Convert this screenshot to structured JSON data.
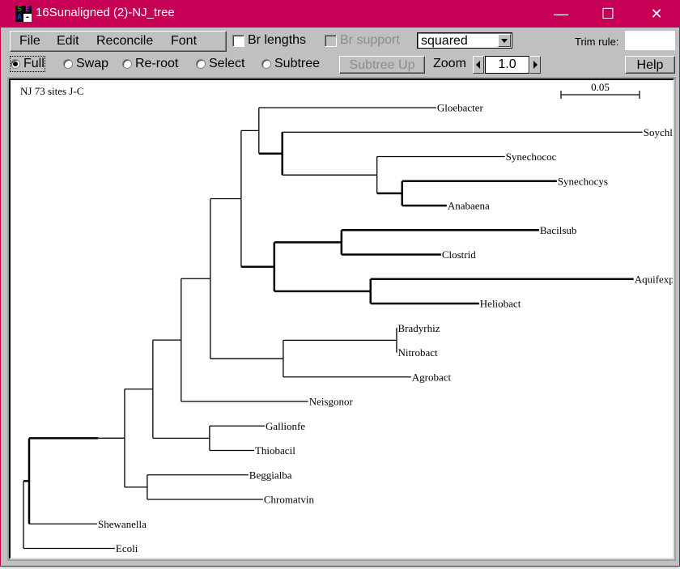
{
  "window": {
    "title": "16Sunaligned (2)-NJ_tree",
    "app_icon_letters": [
      "S",
      "E",
      "A",
      "-"
    ],
    "app_icon_colors": [
      "#00a000",
      "#c000c0",
      "#0040ff",
      "#ffffff"
    ],
    "controls": {
      "minimize": "—",
      "maximize": "☐",
      "close": "✕"
    },
    "titlebar_color": "#c60055"
  },
  "menu": [
    "File",
    "Edit",
    "Reconcile",
    "Font"
  ],
  "toolbar": {
    "br_lengths": {
      "label": "Br lengths",
      "checked": false,
      "enabled": true
    },
    "br_support": {
      "label": "Br support",
      "checked": false,
      "enabled": false
    },
    "tree_style": "squared",
    "trim_rule_label": "Trim rule:",
    "trim_rule_value": "",
    "modes": [
      {
        "label": "Full",
        "selected": true
      },
      {
        "label": "Swap",
        "selected": false
      },
      {
        "label": "Re-root",
        "selected": false
      },
      {
        "label": "Select",
        "selected": false
      },
      {
        "label": "Subtree",
        "selected": false
      }
    ],
    "subtree_up_label": "Subtree Up",
    "zoom_label": "Zoom",
    "zoom_value": "1.0",
    "help_label": "Help"
  },
  "tree": {
    "title": "NJ 73 sites J-C",
    "scale_label": "0.05",
    "scale_value": 0.05,
    "root": {
      "thick": false,
      "children": [
        {
          "len": 0.0036,
          "thick": true,
          "children": [
            {
              "len": 0.0438,
              "thick": true,
              "children": [
                {
                  "len": 0.017,
                  "children": [
                    {
                      "len": 0.018,
                      "children": [
                        {
                          "len": 0.018,
                          "children": [
                            {
                              "len": 0.0186,
                              "children": [
                                {
                                  "len": 0.0196,
                                  "thick": false,
                                  "children": [
                                    {
                                      "len": 0.0113,
                                      "children": [
                                        {
                                          "len": 0.1129,
                                          "name": "Gloebacter"
                                        },
                                        {
                                          "len": 0.0149,
                                          "thick": true,
                                          "children": [
                                            {
                                              "len": 0.2294,
                                              "name": "Soychloro"
                                            },
                                            {
                                              "len": 0.0603,
                                              "children": [
                                                {
                                                  "len": 0.0814,
                                                  "name": "Synechococ"
                                                },
                                                {
                                                  "len": 0.016,
                                                  "thick": true,
                                                  "children": [
                                                    {
                                                      "len": 0.0985,
                                                      "name": "Synechocys",
                                                      "thick": true
                                                    },
                                                    {
                                                      "len": 0.0284,
                                                      "name": "Anabaena",
                                                      "thick": true
                                                    }
                                                  ]
                                                }
                                              ]
                                            }
                                          ]
                                        }
                                      ]
                                    },
                                    {
                                      "len": 0.0211,
                                      "thick": true,
                                      "children": [
                                        {
                                          "len": 0.0428,
                                          "thick": true,
                                          "children": [
                                            {
                                              "len": 0.1258,
                                              "name": "Bacilsub",
                                              "thick": true
                                            },
                                            {
                                              "len": 0.0634,
                                              "name": "Clostrid",
                                              "thick": true
                                            }
                                          ]
                                        },
                                        {
                                          "len": 0.0613,
                                          "thick": true,
                                          "children": [
                                            {
                                              "len": 0.1675,
                                              "name": "Aquifexpy",
                                              "thick": true
                                            },
                                            {
                                              "len": 0.0691,
                                              "name": "Heliobact",
                                              "thick": true
                                            }
                                          ]
                                        }
                                      ]
                                    }
                                  ]
                                },
                                {
                                  "len": 0.0464,
                                  "children": [
                                    {
                                      "len": 0.0722,
                                      "children": [
                                        {
                                          "len": 0.0003,
                                          "name": "Bradyrhiz"
                                        },
                                        {
                                          "len": 0.0003,
                                          "name": "Nitrobact"
                                        }
                                      ]
                                    },
                                    {
                                      "len": 0.0814,
                                      "name": "Agrobact"
                                    }
                                  ]
                                }
                              ]
                            },
                            {
                              "len": 0.0809,
                              "name": "Neisgonor"
                            }
                          ]
                        },
                        {
                          "len": 0.0361,
                          "children": [
                            {
                              "len": 0.0351,
                              "name": "Gallionfe"
                            },
                            {
                              "len": 0.0284,
                              "name": "Thiobacil"
                            }
                          ]
                        }
                      ]
                    },
                    {
                      "len": 0.0144,
                      "children": [
                        {
                          "len": 0.0644,
                          "name": "Beggialba"
                        },
                        {
                          "len": 0.0737,
                          "name": "Chromatvin"
                        }
                      ]
                    }
                  ]
                }
              ]
            },
            {
              "len": 0.0433,
              "name": "Shewanella"
            }
          ]
        },
        {
          "len": 0.0582,
          "name": "Ecoli"
        }
      ]
    }
  }
}
